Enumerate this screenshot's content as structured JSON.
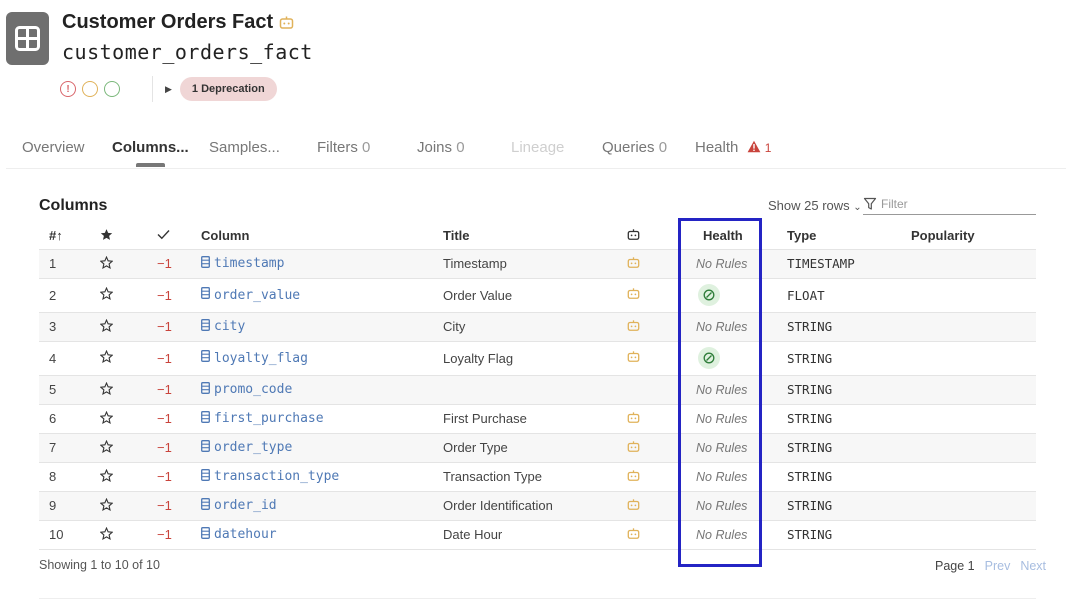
{
  "header": {
    "title": "Customer Orders Fact",
    "subtitle": "customer_orders_fact",
    "deprecation_label": "1 Deprecation",
    "status_circle_mark": "!"
  },
  "tabs": [
    {
      "label": "Overview",
      "count": ""
    },
    {
      "label": "Columns...",
      "count": ""
    },
    {
      "label": "Samples...",
      "count": ""
    },
    {
      "label": "Filters",
      "count": "0"
    },
    {
      "label": "Joins",
      "count": "0"
    },
    {
      "label": "Lineage",
      "count": ""
    },
    {
      "label": "Queries",
      "count": "0"
    },
    {
      "label": "Health",
      "count": "1"
    }
  ],
  "section": {
    "title": "Columns",
    "show_rows": "Show 25 rows",
    "filter_placeholder": "Filter"
  },
  "table": {
    "headers": {
      "num": "#",
      "column": "Column",
      "title": "Title",
      "health": "Health",
      "type": "Type",
      "popularity": "Popularity"
    },
    "rows": [
      {
        "num": "1",
        "score": "−1",
        "column": "timestamp",
        "title": "Timestamp",
        "health": "No Rules",
        "type": "TIMESTAMP"
      },
      {
        "num": "2",
        "score": "−1",
        "column": "order_value",
        "title": "Order Value",
        "health": "",
        "type": "FLOAT"
      },
      {
        "num": "3",
        "score": "−1",
        "column": "city",
        "title": "City",
        "health": "No Rules",
        "type": "STRING"
      },
      {
        "num": "4",
        "score": "−1",
        "column": "loyalty_flag",
        "title": "Loyalty Flag",
        "health": "",
        "type": "STRING"
      },
      {
        "num": "5",
        "score": "−1",
        "column": "promo_code",
        "title": "",
        "health": "No Rules",
        "type": "STRING"
      },
      {
        "num": "6",
        "score": "−1",
        "column": "first_purchase",
        "title": "First Purchase",
        "health": "No Rules",
        "type": "STRING"
      },
      {
        "num": "7",
        "score": "−1",
        "column": "order_type",
        "title": "Order Type",
        "health": "No Rules",
        "type": "STRING"
      },
      {
        "num": "8",
        "score": "−1",
        "column": "transaction_type",
        "title": "Transaction Type",
        "health": "No Rules",
        "type": "STRING"
      },
      {
        "num": "9",
        "score": "−1",
        "column": "order_id",
        "title": "Order Identification",
        "health": "No Rules",
        "type": "STRING"
      },
      {
        "num": "10",
        "score": "−1",
        "column": "datehour",
        "title": "Date Hour",
        "health": "No Rules",
        "type": "STRING"
      }
    ]
  },
  "footer": {
    "showing": "Showing 1 to 10 of 10",
    "page": "Page 1",
    "prev": "Prev",
    "next": "Next"
  },
  "colors": {
    "accent_blue": "#4f79b5",
    "negative_red": "#c9443c",
    "highlight_box": "#2424c4",
    "bot_icon": "#e0a82e"
  },
  "icons": {
    "app": "table-grid-icon",
    "title_badge": "bot-icon",
    "rank": "star-icon",
    "check": "checkmark-icon",
    "column_type": "column-icon",
    "health_ok": "health-ok-icon",
    "alert": "warning-triangle-icon",
    "filter": "funnel-icon",
    "sort": "sort-up-icon"
  }
}
